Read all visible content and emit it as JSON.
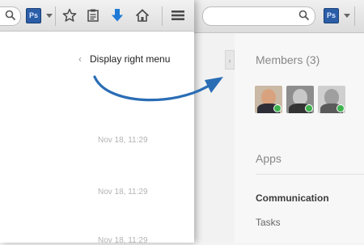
{
  "toolbar": {
    "ps_label": "Ps"
  },
  "hint": {
    "chevron": "‹",
    "label": "Display right menu"
  },
  "timestamps": [
    "Nov 18, 11:29",
    "Nov 18, 11:29",
    "Nov 18, 11:29"
  ],
  "right_panel": {
    "members_title": "Members (3)",
    "members": [
      {
        "icon": "avatar-photo",
        "online": true
      },
      {
        "icon": "avatar-photo",
        "online": true
      },
      {
        "icon": "avatar-photo",
        "online": true
      }
    ],
    "apps_title": "Apps",
    "apps": [
      "Communication",
      "Tasks"
    ],
    "toggle_chevron": "›"
  },
  "colors": {
    "arrow": "#2a6db5",
    "online": "#3fb34f",
    "download": "#1e7ad6"
  }
}
